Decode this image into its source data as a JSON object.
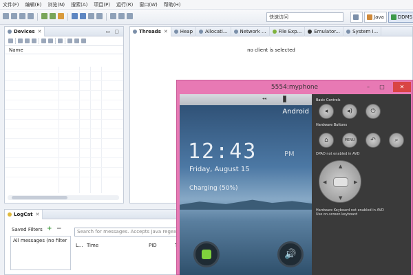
{
  "menu": [
    "文件(F)",
    "编辑(E)",
    "浏览(N)",
    "搜索(A)",
    "项目(P)",
    "运行(R)",
    "窗口(W)",
    "帮助(H)"
  ],
  "toolbar": {
    "quick_access": "快速访问",
    "perspectives": [
      {
        "label": "Java",
        "color": "#d08a3a"
      },
      {
        "label": "DDMS",
        "color": "#3d9a4a"
      }
    ]
  },
  "devices": {
    "tab": "Devices",
    "column_name": "Name"
  },
  "threads": {
    "tabs": [
      "Threads",
      "Heap",
      "Allocati...",
      "Network ...",
      "File Exp...",
      "Emulator...",
      "System I..."
    ],
    "message": "no client is selected"
  },
  "logcat": {
    "tab": "LogCat",
    "saved_filters": "Saved Filters",
    "filter_item": "All messages (no filter",
    "search_placeholder": "Search for messages. Accepts Java regexe",
    "columns": [
      "L...",
      "Time",
      "PID",
      "T"
    ]
  },
  "emulator": {
    "title": "5554:myphone",
    "carrier": "Android",
    "clock": "12:43",
    "ampm": "PM",
    "date": "Friday, August 15",
    "charging": "Charging (50%)",
    "basic_controls": "Basic Controls",
    "hardware_buttons": "Hardware Buttons",
    "menu_label": "MENU",
    "dpad_note": "DPAD not enabled in AVD",
    "keyboard_note_1": "Hardware Keyboard not enabled in AVD",
    "keyboard_note_2": "Use on-screen keyboard"
  }
}
